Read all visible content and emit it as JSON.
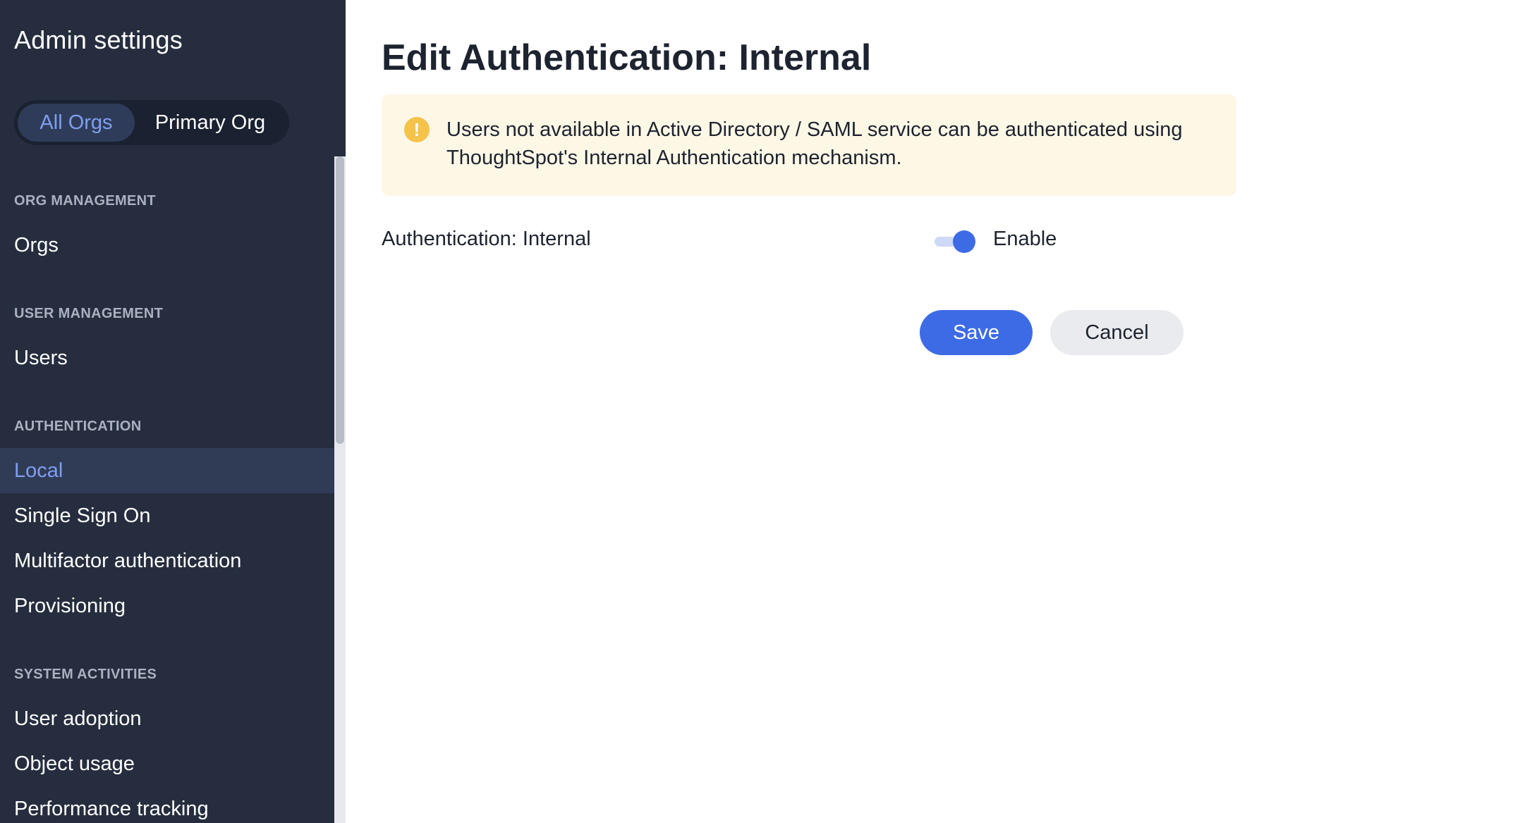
{
  "sidebar": {
    "title": "Admin settings",
    "org_switch": {
      "options": [
        "All Orgs",
        "Primary Org"
      ],
      "selected": "All Orgs"
    },
    "sections": [
      {
        "heading": "ORG MANAGEMENT",
        "items": [
          "Orgs"
        ]
      },
      {
        "heading": "USER MANAGEMENT",
        "items": [
          "Users"
        ]
      },
      {
        "heading": "AUTHENTICATION",
        "items": [
          "Local",
          "Single Sign On",
          "Multifactor authentication",
          "Provisioning"
        ]
      },
      {
        "heading": "SYSTEM ACTIVITIES",
        "items": [
          "User adoption",
          "Object usage",
          "Performance tracking"
        ]
      }
    ],
    "selected_item": "Local"
  },
  "main": {
    "title": "Edit Authentication: Internal",
    "notice": {
      "icon": "warning-icon",
      "text": "Users not available in Active Directory / SAML service can be authenticated using ThoughtSpot's Internal Authentication mechanism."
    },
    "setting": {
      "label": "Authentication: Internal",
      "toggle_on": true,
      "toggle_label": "Enable"
    },
    "buttons": {
      "save": "Save",
      "cancel": "Cancel"
    }
  },
  "colors": {
    "sidebar_bg": "#252d3e",
    "accent": "#3d6be5",
    "selected_text": "#7e9ff0",
    "notice_bg": "#fdf7e6",
    "warning": "#f5c34a"
  }
}
